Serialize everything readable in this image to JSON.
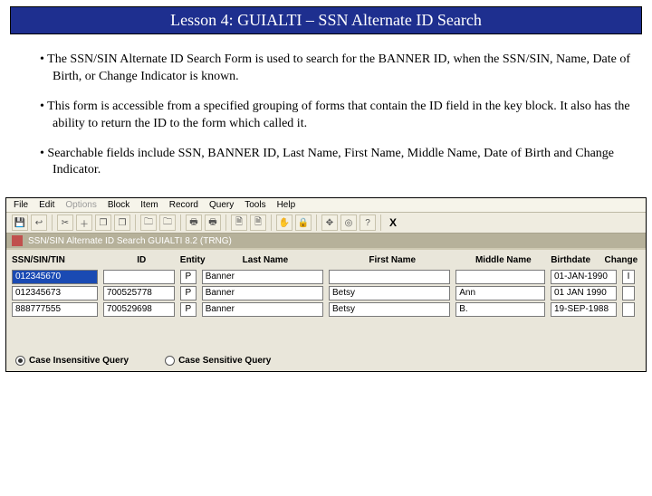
{
  "title": "Lesson 4: GUIALTI – SSN Alternate ID  Search",
  "paragraphs": [
    "The SSN/SIN Alternate ID Search Form is used to search for the BANNER ID, when the  SSN/SIN, Name, Date of Birth, or Change Indicator is known.",
    "This form is accessible from a specified grouping of forms that contain the ID field in the key block. It also has the ability to return the ID to the form which called it.",
    "Searchable fields include SSN, BANNER ID, Last Name, First Name, Middle Name, Date of Birth and Change Indicator."
  ],
  "menu": {
    "items": [
      "File",
      "Edit",
      "Options",
      "Block",
      "Item",
      "Record",
      "Query",
      "Tools",
      "Help"
    ],
    "disabled": [
      "Options"
    ]
  },
  "toolbar": {
    "icons": [
      "save",
      "chevrons",
      "scissors",
      "plus",
      "copy",
      "copy2",
      "copy3",
      "print",
      "print2",
      "folder",
      "folder2",
      "doc",
      "hand",
      "lock",
      "crosshair",
      "target",
      "question",
      "xmark"
    ]
  },
  "form_header": "SSN/SIN Alternate ID Search  GUIALTI  8.2  (TRNG)",
  "columns": {
    "ssn": "SSN/SIN/TIN",
    "id": "ID",
    "entity": "Entity",
    "last": "Last Name",
    "first": "First Name",
    "middle": "Middle Name",
    "birth": "Birthdate",
    "change": "Change"
  },
  "rows": [
    {
      "ssn": "012345670",
      "id": "",
      "entity": "P",
      "last": "Banner",
      "first": "",
      "middle": "",
      "birth": "01-JAN-1990",
      "change": "I"
    },
    {
      "ssn": "012345673",
      "id": "700525778",
      "entity": "P",
      "last": "Banner",
      "first": "Betsy",
      "middle": "Ann",
      "birth": "01 JAN 1990",
      "change": ""
    },
    {
      "ssn": "888777555",
      "id": "700529698",
      "entity": "P",
      "last": "Banner",
      "first": "Betsy",
      "middle": "B.",
      "birth": "19-SEP-1988",
      "change": ""
    }
  ],
  "radios": {
    "insensitive": "Case Insensitive Query",
    "sensitive": "Case Sensitive Query"
  },
  "close_x": "X"
}
